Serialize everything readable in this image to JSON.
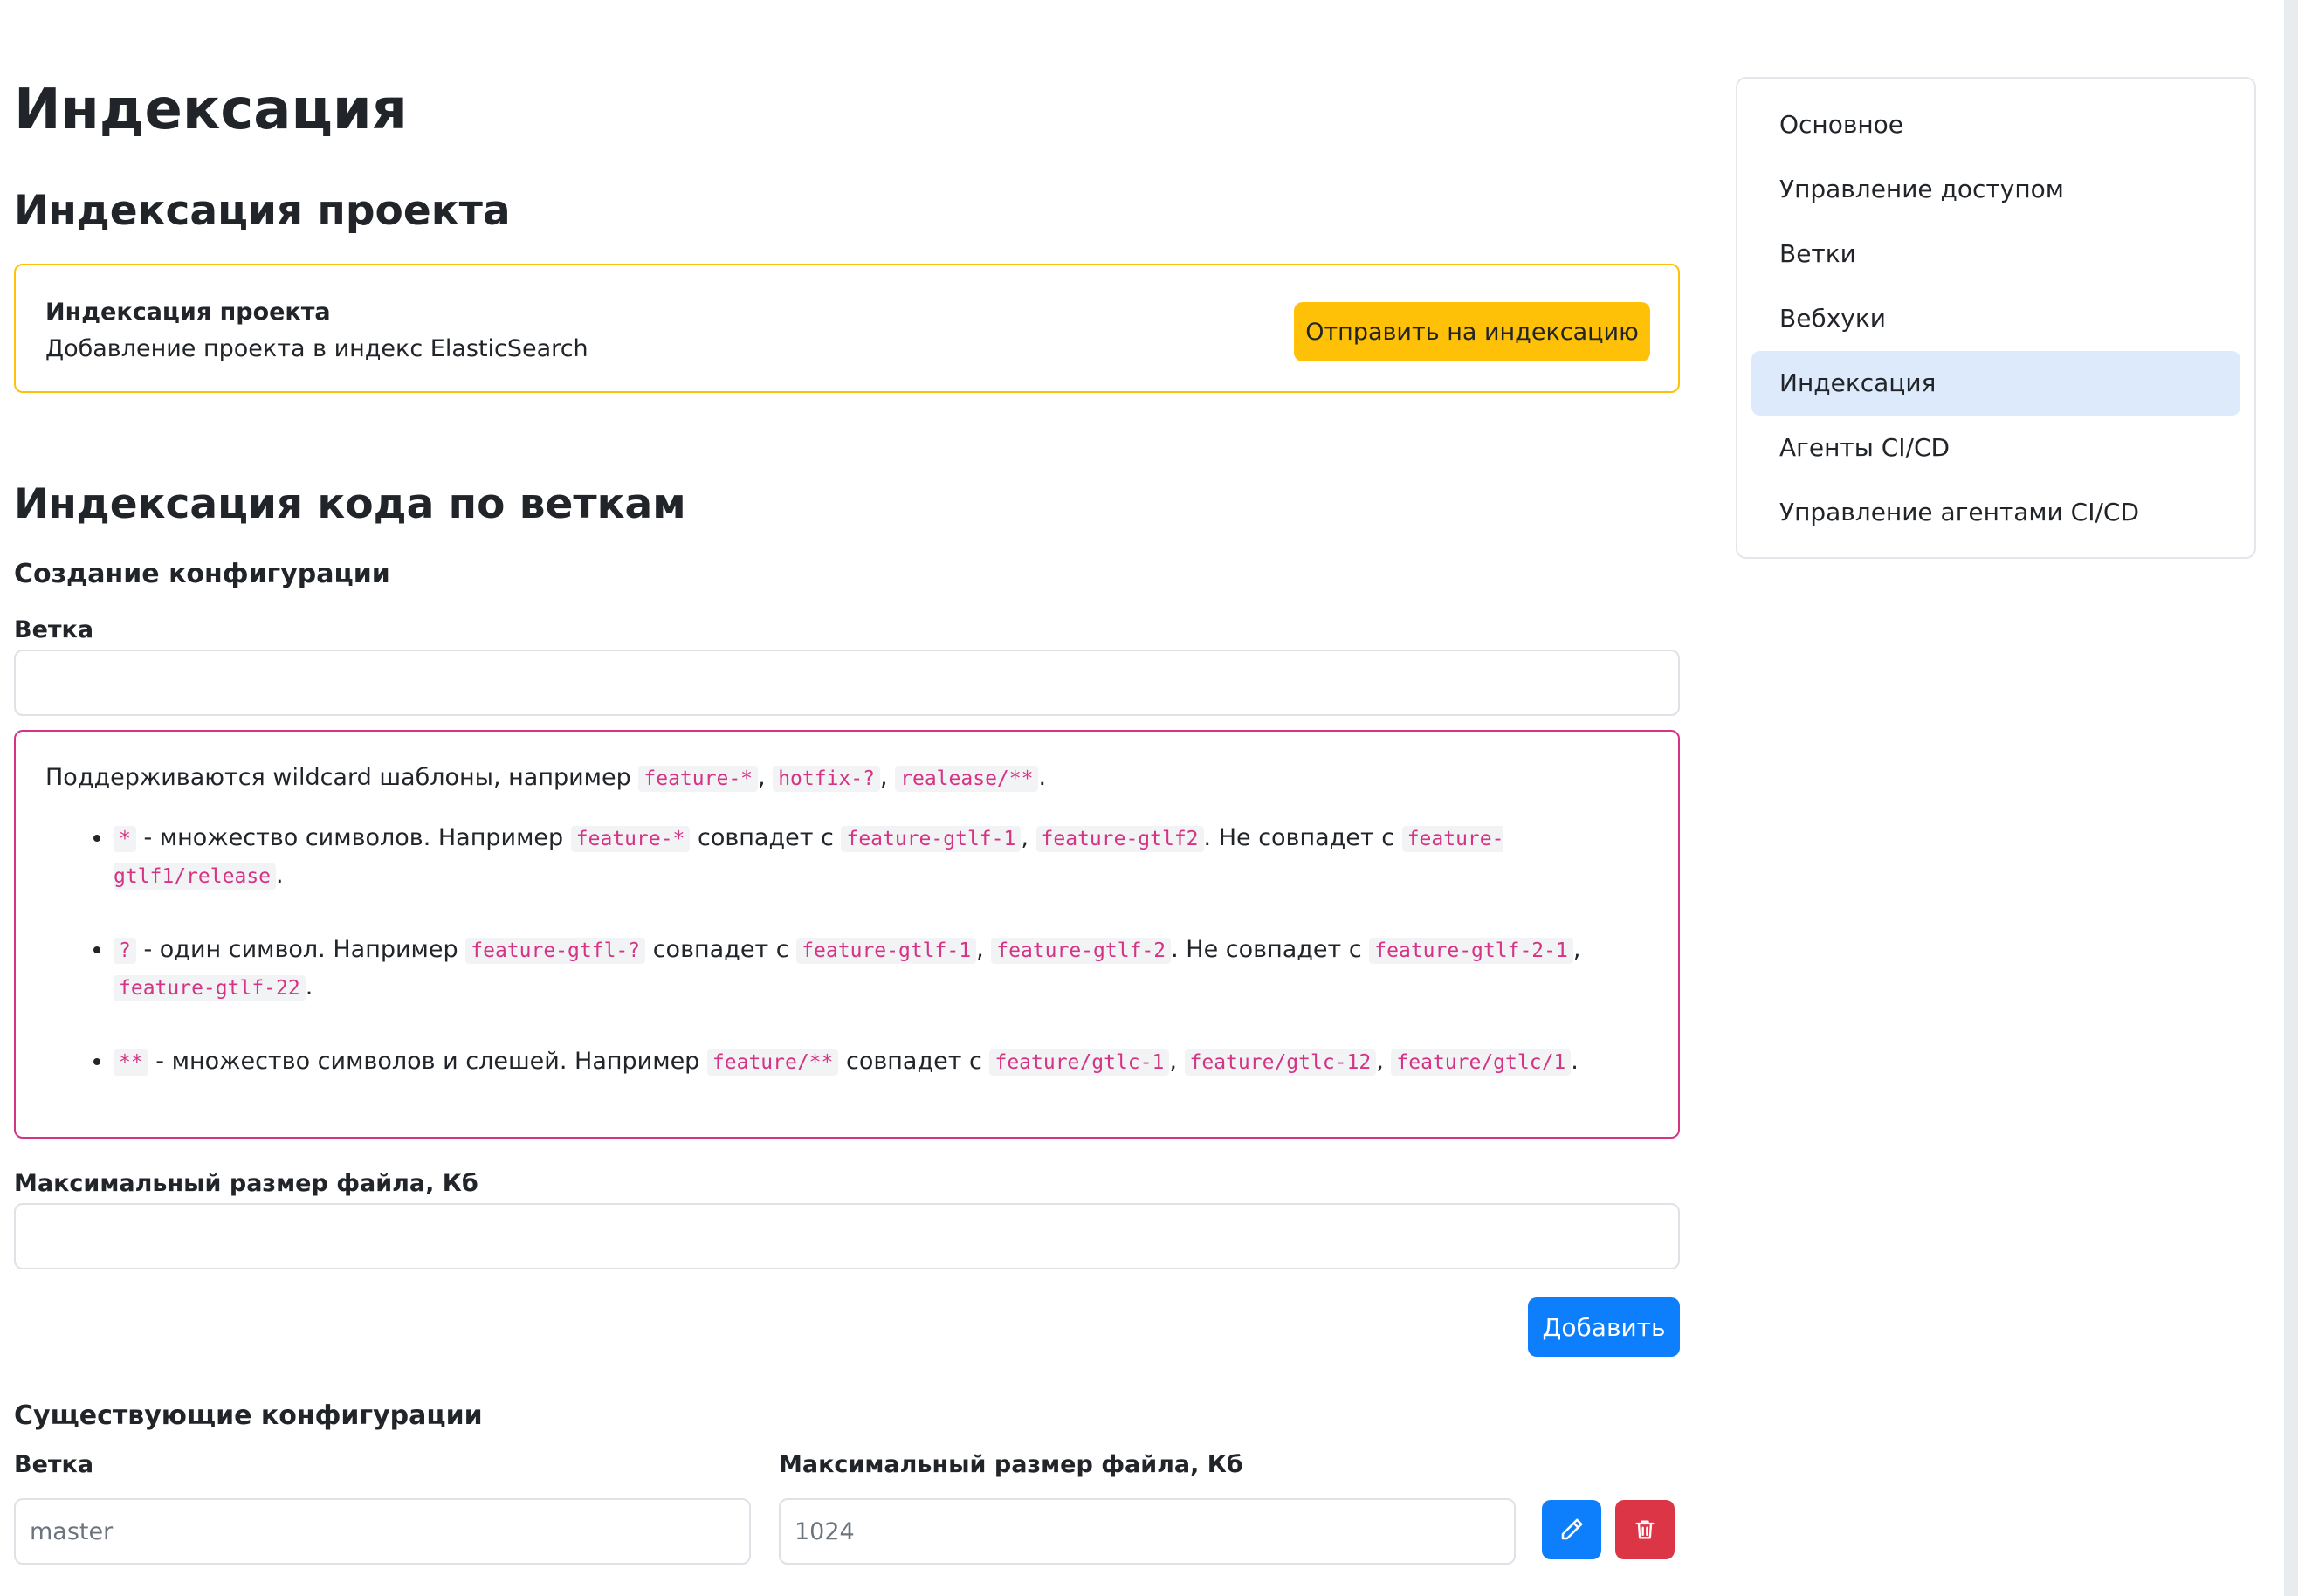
{
  "page": {
    "title": "Индексация"
  },
  "project_indexing": {
    "heading": "Индексация проекта",
    "card_title": "Индексация проекта",
    "card_desc": "Добавление проекта в индекс ElasticSearch",
    "button_label": "Отправить на индексацию"
  },
  "branch_indexing": {
    "heading": "Индексация кода по веткам",
    "create_heading": "Создание конфигурации",
    "branch_label": "Ветка",
    "branch_value": "",
    "help": {
      "intro": "Поддерживаются wildcard шаблоны, например ",
      "intro_codes": [
        "feature-*",
        "hotfix-?",
        "realease/**"
      ],
      "items": [
        {
          "symbol": "*",
          "t1": " - множество символов. Например ",
          "ex": "feature-*",
          "t2": " совпадет с ",
          "match": [
            "feature-gtlf-1",
            "feature-gtlf2"
          ],
          "t3": ". Не совпадет с ",
          "nomatch": [
            "feature-gtlf1/release"
          ]
        },
        {
          "symbol": "?",
          "t1": " - один символ. Например ",
          "ex": "feature-gtfl-?",
          "t2": " совпадет с ",
          "match": [
            "feature-gtlf-1",
            "feature-gtlf-2"
          ],
          "t3": ". Не совпадет с ",
          "nomatch": [
            "feature-gtlf-2-1",
            "feature-gtlf-22"
          ]
        },
        {
          "symbol": "**",
          "t1": " - множество символов и слешей. Например ",
          "ex": "feature/**",
          "t2": " совпадет с ",
          "match": [
            "feature/gtlc-1",
            "feature/gtlc-12",
            "feature/gtlc/1"
          ]
        }
      ]
    },
    "max_size_label": "Максимальный размер файла, Кб",
    "max_size_value": "",
    "add_button": "Добавить",
    "existing_heading": "Существующие конфигурации",
    "col_branch": "Ветка",
    "col_max_size": "Максимальный размер файла, Кб",
    "configs": [
      {
        "branch": "master",
        "max_size": "1024"
      }
    ]
  },
  "sidebar": {
    "items": [
      {
        "label": "Основное",
        "active": false
      },
      {
        "label": "Управление доступом",
        "active": false
      },
      {
        "label": "Ветки",
        "active": false
      },
      {
        "label": "Вебхуки",
        "active": false
      },
      {
        "label": "Индексация",
        "active": true
      },
      {
        "label": "Агенты CI/CD",
        "active": false
      },
      {
        "label": "Управление агентами CI/CD",
        "active": false
      }
    ]
  },
  "colors": {
    "warning": "#ffc107",
    "primary": "#0d7ffc",
    "danger": "#dc3545",
    "code": "#d63384",
    "nav_active": "#dceafb"
  },
  "icons": {
    "edit": "pencil-icon",
    "delete": "trash-icon"
  }
}
